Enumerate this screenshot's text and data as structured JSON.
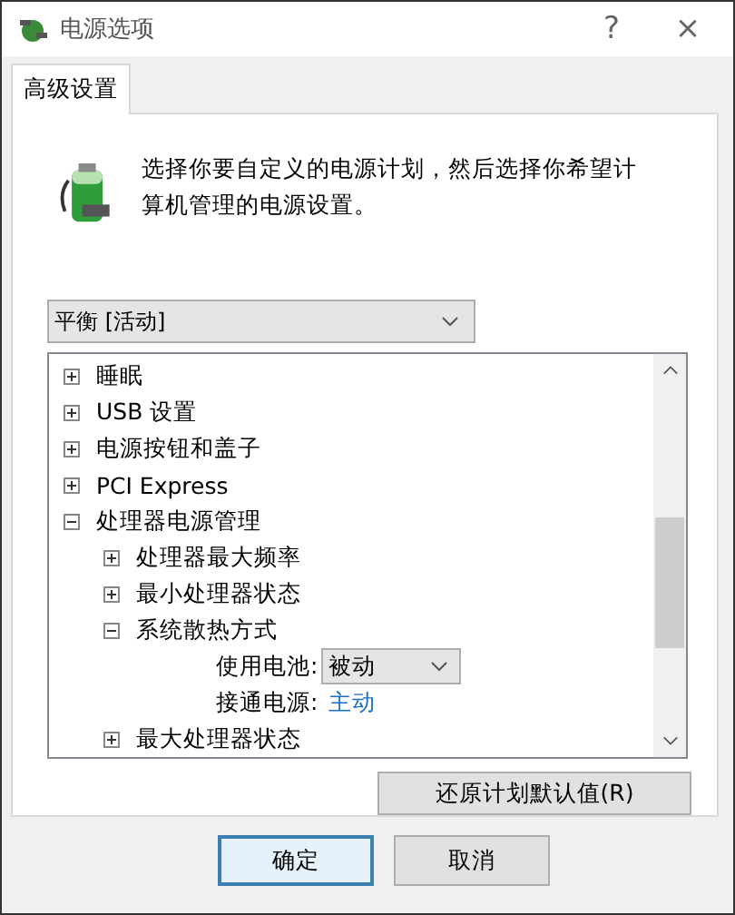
{
  "window": {
    "title": "电源选项",
    "help": "?",
    "close": "×"
  },
  "tabs": [
    {
      "label": "高级设置",
      "selected": true
    }
  ],
  "description": "选择你要自定义的电源计划，然后选择你希望计算机管理的电源设置。",
  "plan_select": {
    "value": "平衡 [活动]"
  },
  "tree": [
    {
      "label": "睡眠",
      "expanded": false
    },
    {
      "label": "USB 设置",
      "expanded": false
    },
    {
      "label": "电源按钮和盖子",
      "expanded": false
    },
    {
      "label": "PCI Express",
      "expanded": false
    },
    {
      "label": "处理器电源管理",
      "expanded": true,
      "children": [
        {
          "label": "处理器最大频率",
          "expanded": false
        },
        {
          "label": "最小处理器状态",
          "expanded": false
        },
        {
          "label": "系统散热方式",
          "expanded": true,
          "children": [
            {
              "kind": "dropdown",
              "label": "使用电池:",
              "value": "被动"
            },
            {
              "kind": "link",
              "label": "接通电源:",
              "value": "主动"
            }
          ]
        },
        {
          "label": "最大处理器状态",
          "expanded": false
        }
      ]
    }
  ],
  "restore_button": "还原计划默认值(R)",
  "buttons": [
    {
      "label": "确定",
      "default": true
    },
    {
      "label": "取消",
      "default": false
    }
  ]
}
